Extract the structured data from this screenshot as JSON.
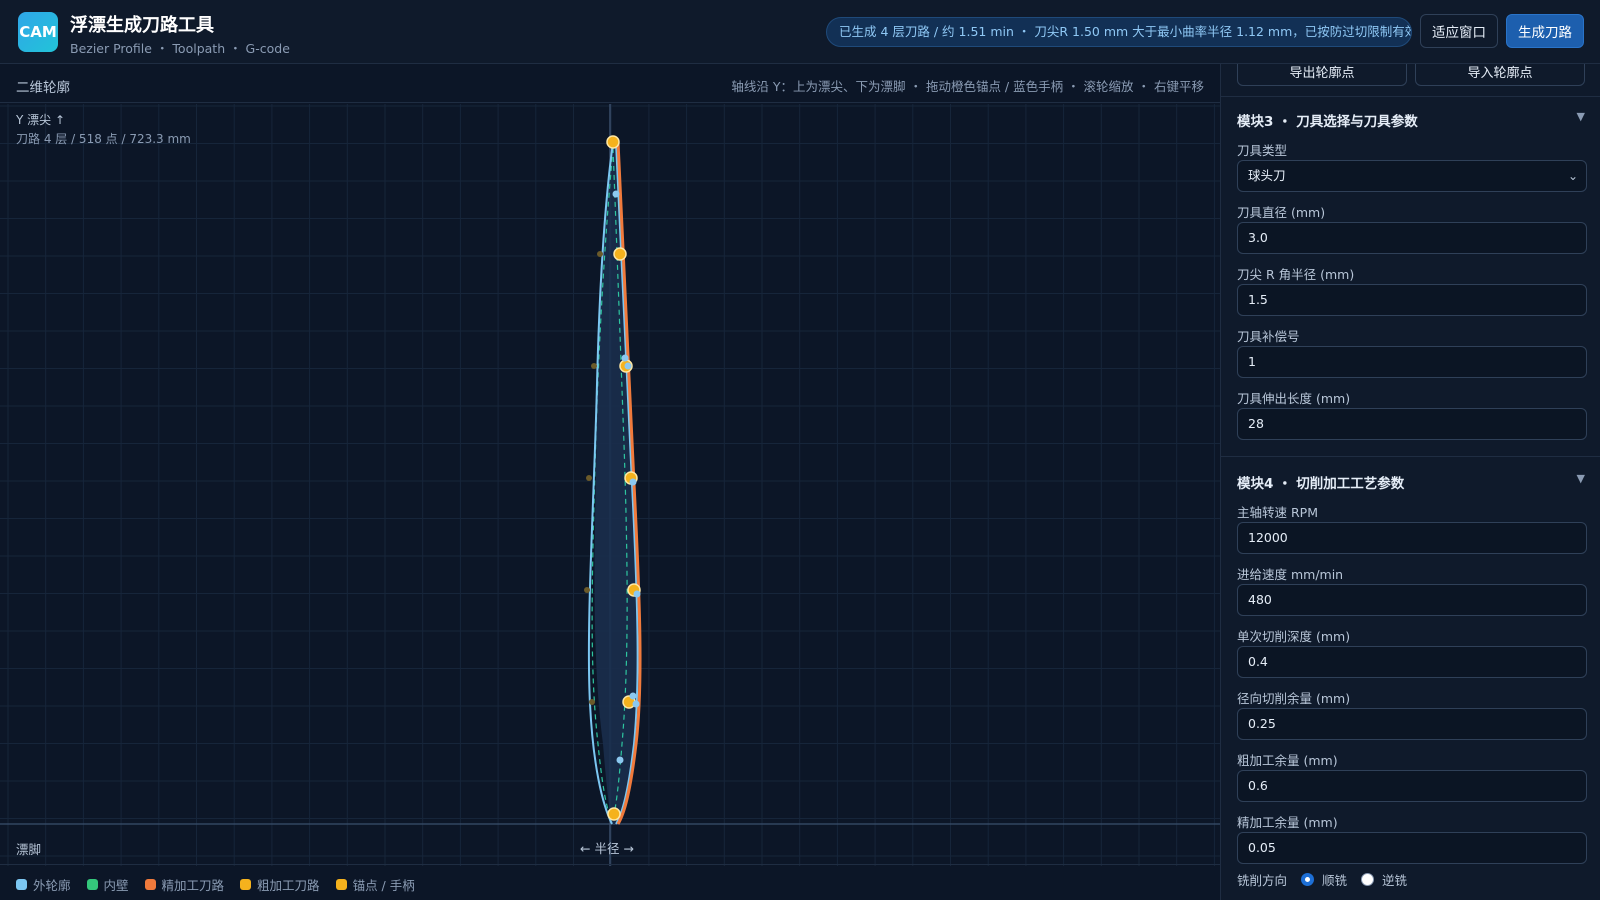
{
  "header": {
    "logo_text": "CAM",
    "title": "浮漂生成刀路工具",
    "subtitle": "Bezier Profile ・ Toolpath ・ G-code",
    "status": "已生成 4 层刀路 / 约 1.51 min ・ 刀尖R 1.50 mm 大于最小曲率半径 1.12 mm，已按防过切限制有效半径。",
    "fit_button": "适应窗口",
    "generate_button": "生成刀路"
  },
  "canvas": {
    "title": "二维轮廓",
    "hint": "轴线沿 Y：上为漂尖、下为漂脚 ・ 拖动橙色锚点 / 蓝色手柄 ・ 滚轮缩放 ・ 右键平移",
    "y_label": "Y 漂尖 ↑",
    "stats": "刀路 4 层 / 518 点 / 723.3 mm",
    "bottom_label": "漂脚",
    "radius_label": "← 半径 →"
  },
  "legend": [
    {
      "label": "外轮廓",
      "color": "#7cc7f2"
    },
    {
      "label": "内壁",
      "color": "#34c77b"
    },
    {
      "label": "精加工刀路",
      "color": "#f07a3c"
    },
    {
      "label": "粗加工刀路",
      "color": "#f5b21d"
    },
    {
      "label": "锚点 / 手柄",
      "color": "#f5b21d"
    }
  ],
  "panel": {
    "top_buttons": [
      "导出轮廓点",
      "导入轮廓点"
    ],
    "module3": {
      "title": "模块3 ・ 刀具选择与刀具参数",
      "tool_type_label": "刀具类型",
      "tool_type_value": "球头刀",
      "diameter_label": "刀具直径 (mm)",
      "diameter_value": "3.0",
      "radius_label": "刀尖 R 角半径 (mm)",
      "radius_value": "1.5",
      "offset_label": "刀具补偿号",
      "offset_value": "1",
      "extension_label": "刀具伸出长度 (mm)",
      "extension_value": "28"
    },
    "module4": {
      "title": "模块4 ・ 切削加工工艺参数",
      "rpm_label": "主轴转速 RPM",
      "rpm_value": "12000",
      "feed_label": "进给速度 mm/min",
      "feed_value": "480",
      "depth_label": "单次切削深度 (mm)",
      "depth_value": "0.4",
      "radial_label": "径向切削余量 (mm)",
      "radial_value": "0.25",
      "rough_label": "粗加工余量 (mm)",
      "rough_value": "0.6",
      "finish_label": "精加工余量 (mm)",
      "finish_value": "0.05",
      "direction_label": "铣削方向",
      "direction_climb": "顺铣",
      "direction_conventional": "逆铣"
    }
  }
}
